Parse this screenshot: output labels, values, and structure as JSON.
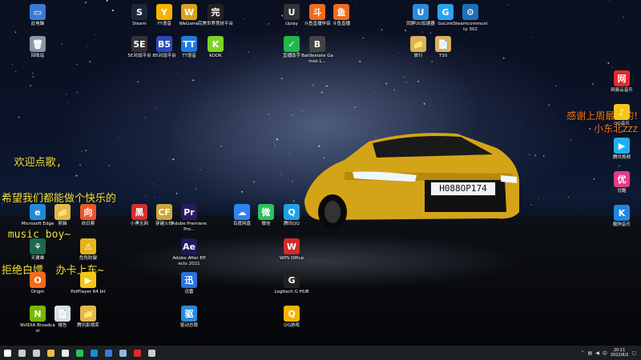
{
  "desktop": {
    "overlay_left_lines": [
      "  欢迎点歌,",
      "希望我们都能做个快乐的",
      " music boy~",
      "拒绝白嫖  办卡上车~"
    ],
    "overlay_right_lines": [
      "感谢上周最爱的!",
      "小东北zzz"
    ],
    "plate_text": "H088OP174",
    "icons": [
      {
        "label": "此电脑",
        "glyph": "▭",
        "color": "#3a7bd5"
      },
      {
        "label": "回收站",
        "glyph": "🗑",
        "color": "#8896a8"
      },
      {
        "label": "Steam",
        "glyph": "S",
        "color": "#1b2838"
      },
      {
        "label": "YY语音",
        "glyph": "Y",
        "color": "#f5b400"
      },
      {
        "label": "WeGame",
        "glyph": "W",
        "color": "#d9a21b"
      },
      {
        "label": "完美世界竞技平台",
        "glyph": "完",
        "color": "#222"
      },
      {
        "label": "Uplay",
        "glyph": "U",
        "color": "#333"
      },
      {
        "label": "斗鱼直播伴侣",
        "glyph": "斗",
        "color": "#f26b1d"
      },
      {
        "label": "斗鱼直播",
        "glyph": "鱼",
        "color": "#f26b1d"
      },
      {
        "label": "同屏UU加速器",
        "glyph": "U",
        "color": "#2b8bd6"
      },
      {
        "label": "GoLink",
        "glyph": "G",
        "color": "#2ba0f0"
      },
      {
        "label": "Steamcommunity 302",
        "glyph": "⚙",
        "color": "#1d6fb8"
      },
      {
        "label": "5E对战平台",
        "glyph": "5E",
        "color": "#333"
      },
      {
        "label": "B5对战平台",
        "glyph": "B5",
        "color": "#2b4ab8"
      },
      {
        "label": "TT语音",
        "glyph": "TT",
        "color": "#1e7be0"
      },
      {
        "label": "KOOK",
        "glyph": "K",
        "color": "#7ed321"
      },
      {
        "label": "直播助手",
        "glyph": "✓",
        "color": "#1fb84b"
      },
      {
        "label": "Battlestate Games L...",
        "glyph": "B",
        "color": "#444"
      },
      {
        "label": "旅行",
        "glyph": "📁",
        "color": "#d9b25a"
      },
      {
        "label": "T30",
        "glyph": "📄",
        "color": "#d9b25a"
      },
      {
        "label": "Microsoft Edge",
        "glyph": "e",
        "color": "#1f8ad8"
      },
      {
        "label": "剪辑",
        "glyph": "📁",
        "color": "#e0b94a"
      },
      {
        "label": "向日葵",
        "glyph": "向",
        "color": "#e8582b"
      },
      {
        "label": "小黑无网",
        "glyph": "黑",
        "color": "#d62e2e"
      },
      {
        "label": "穿越火线",
        "glyph": "CF",
        "color": "#caa63d"
      },
      {
        "label": "Adobe Premiere Pro...",
        "glyph": "Pr",
        "color": "#2a1a5e"
      },
      {
        "label": "百度网盘",
        "glyph": "☁",
        "color": "#2f82f0"
      },
      {
        "label": "微信",
        "glyph": "微",
        "color": "#2cc05a"
      },
      {
        "label": "腾讯QQ",
        "glyph": "Q",
        "color": "#1fa0e8"
      },
      {
        "label": "天翼雄",
        "glyph": "⚘",
        "color": "#1a6a4b"
      },
      {
        "label": "危险防御",
        "glyph": "⚠",
        "color": "#e8b21a"
      },
      {
        "label": "Adobe After Effects 2021",
        "glyph": "Ae",
        "color": "#1a1a5e"
      },
      {
        "label": "WPS Office",
        "glyph": "W",
        "color": "#d32b2b"
      },
      {
        "label": "Origin",
        "glyph": "O",
        "color": "#f26b1d"
      },
      {
        "label": "PotPlayer 64 bit",
        "glyph": "▶",
        "color": "#f5c518"
      },
      {
        "label": "迅雷",
        "glyph": "迅",
        "color": "#2a72e0"
      },
      {
        "label": "Logitech G HUB",
        "glyph": "G",
        "color": "#222"
      },
      {
        "label": "NVIDIA Broadcast",
        "glyph": "N",
        "color": "#76b900"
      },
      {
        "label": "报告",
        "glyph": "📄",
        "color": "#e0e0e0"
      },
      {
        "label": "腾讯影视库",
        "glyph": "📁",
        "color": "#e0b94a"
      },
      {
        "label": "驱动总裁",
        "glyph": "驱",
        "color": "#2a8ae0"
      },
      {
        "label": "QQ游戏",
        "glyph": "Q",
        "color": "#f5b400"
      },
      {
        "label": "网易云音乐",
        "glyph": "网",
        "color": "#e02b2b"
      },
      {
        "label": "QQ音乐",
        "glyph": "♪",
        "color": "#f5c518"
      },
      {
        "label": "腾讯视频",
        "glyph": "▶",
        "color": "#20b0f0"
      },
      {
        "label": "优酷",
        "glyph": "优",
        "color": "#e83a8a"
      },
      {
        "label": "酷狗音乐",
        "glyph": "K",
        "color": "#1e88e5"
      }
    ]
  },
  "taskbar": {
    "items": [
      {
        "name": "start",
        "color": "#ffffff"
      },
      {
        "name": "search",
        "color": "#cccccc"
      },
      {
        "name": "taskview",
        "color": "#cccccc"
      },
      {
        "name": "explorer",
        "color": "#e8c04a"
      },
      {
        "name": "store",
        "color": "#e8e8e8"
      },
      {
        "name": "wechat",
        "color": "#2cc05a"
      },
      {
        "name": "edge",
        "color": "#1f8ad8"
      },
      {
        "name": "photos",
        "color": "#3a7bd5"
      },
      {
        "name": "steam",
        "color": "#8fb8d8"
      },
      {
        "name": "netease",
        "color": "#e02b2b"
      },
      {
        "name": "obs",
        "color": "#cccccc"
      }
    ],
    "clock_time": "20:11",
    "clock_date": "2022/6/2"
  }
}
